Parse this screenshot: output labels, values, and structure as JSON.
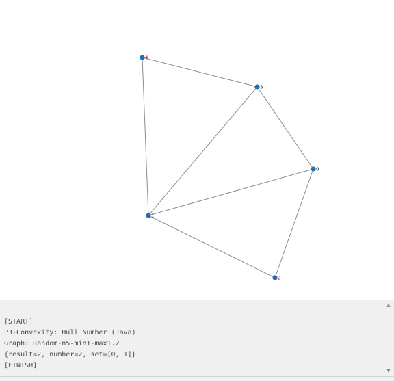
{
  "graph": {
    "nodes": [
      {
        "id": "0",
        "label": "0",
        "label_color": "#1a1a1a"
      },
      {
        "id": "1",
        "label": "1",
        "label_color": "#1a1a1a"
      },
      {
        "id": "2",
        "label": "2",
        "label_color": "#d0021b"
      },
      {
        "id": "3",
        "label": "3",
        "label_color": "#1a1a1a"
      },
      {
        "id": "4",
        "label": "4",
        "label_color": "#d0021b"
      }
    ],
    "edges": [
      [
        "4",
        "3"
      ],
      [
        "4",
        "1"
      ],
      [
        "3",
        "1"
      ],
      [
        "3",
        "0"
      ],
      [
        "1",
        "0"
      ],
      [
        "1",
        "2"
      ],
      [
        "0",
        "2"
      ]
    ],
    "node_color": "#1f6fb2",
    "edge_color": "#8c8c8c"
  },
  "console": {
    "lines": [
      "[START]",
      "P3-Convexity: Hull Number (Java)",
      "Graph: Random-n5-min1-max1.2",
      "{result=2, number=2, set=[0, 1]}",
      "[FINISH]"
    ],
    "scroll_up_glyph": "▲",
    "scroll_down_glyph": "▼"
  }
}
